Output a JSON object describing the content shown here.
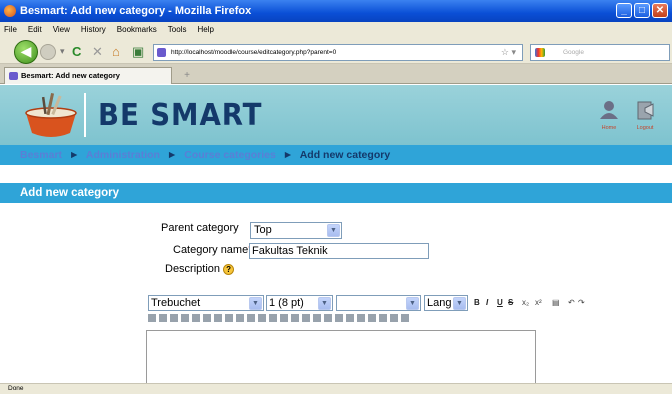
{
  "window": {
    "title": "Besmart: Add new category - Mozilla Firefox"
  },
  "menu": [
    "File",
    "Edit",
    "View",
    "History",
    "Bookmarks",
    "Tools",
    "Help"
  ],
  "browser": {
    "url": "http://localhost/moodle/course/editcategory.php?parent=0",
    "search_placeholder": "Google",
    "tab_title": "Besmart: Add new category",
    "status": "Done"
  },
  "site": {
    "logo_text": "BE SMART",
    "header_links": [
      {
        "label": "Home"
      },
      {
        "label": "Logout"
      }
    ]
  },
  "breadcrumb": {
    "items": [
      "Besmart",
      "Administration",
      "Course categories"
    ],
    "separator": "►",
    "current": "Add new category"
  },
  "form": {
    "section_title": "Add new category",
    "parent_label": "Parent category",
    "parent_value": "Top",
    "name_label": "Category name",
    "name_required": "*",
    "name_value": "Fakultas Teknik",
    "description_label": "Description",
    "editor": {
      "font": "Trebuchet",
      "size": "1 (8 pt)",
      "heading": "",
      "lang": "Lang"
    }
  }
}
